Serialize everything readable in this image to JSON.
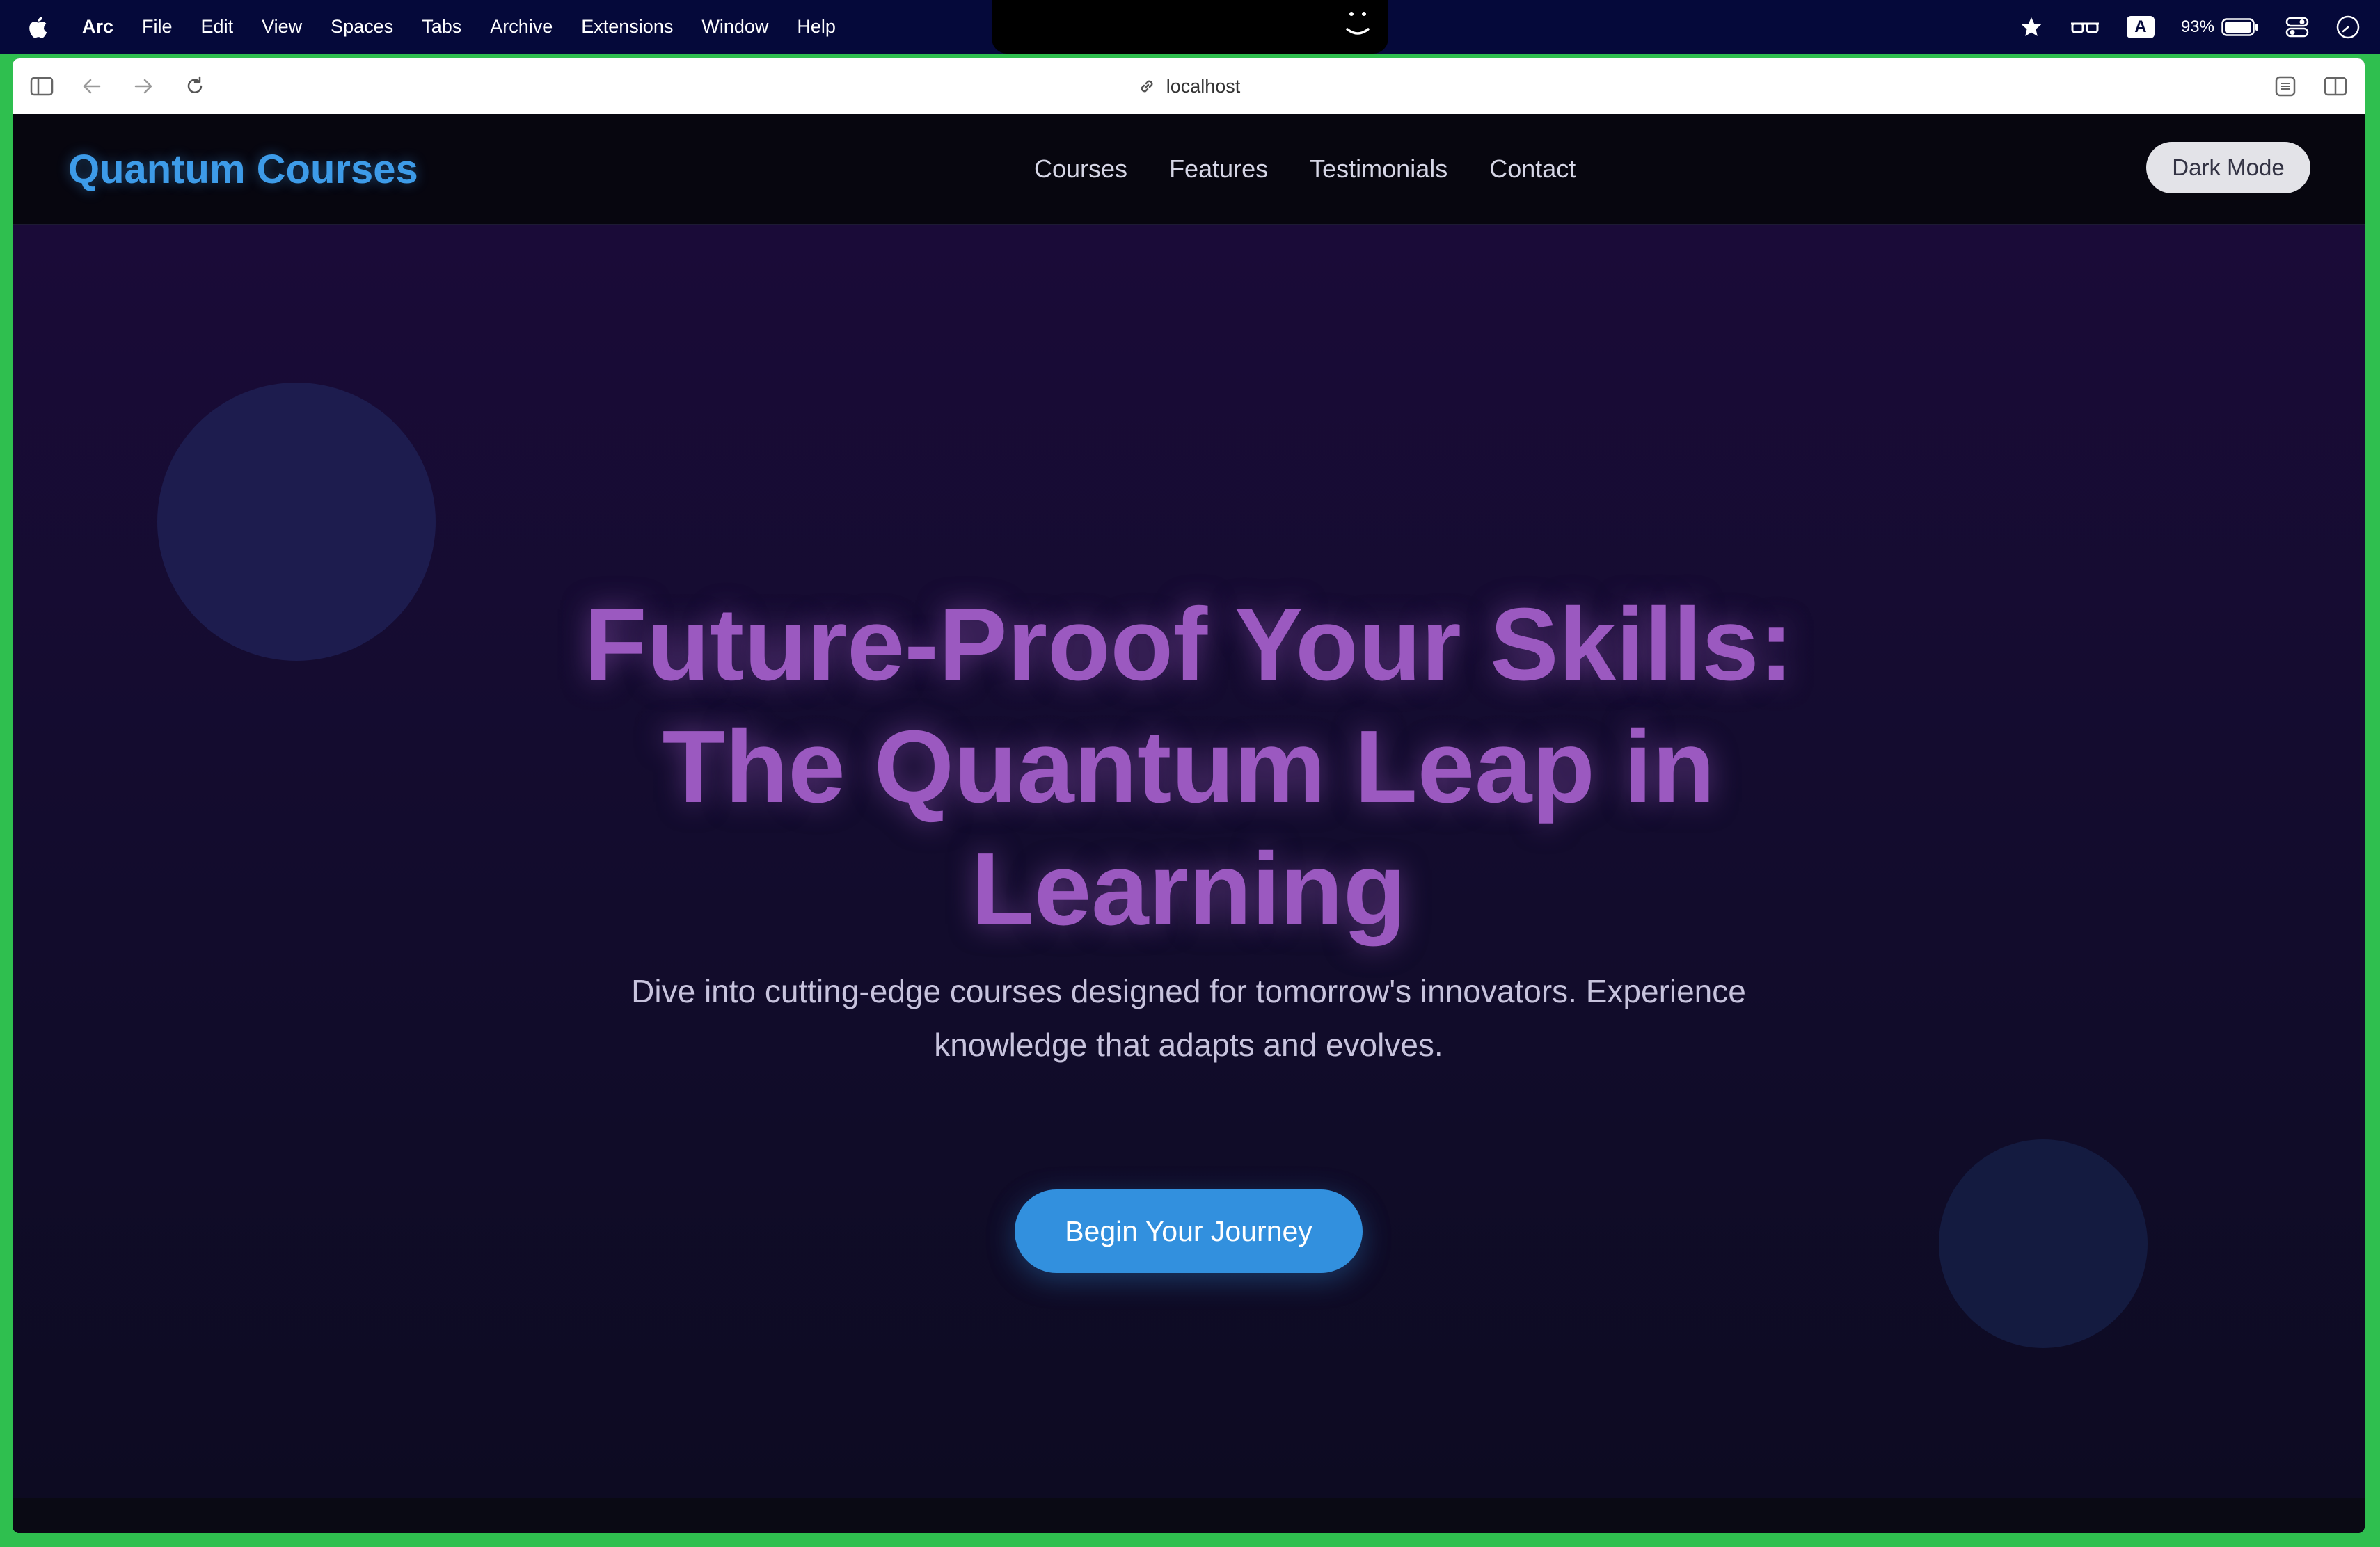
{
  "menubar": {
    "app_name": "Arc",
    "items": [
      "File",
      "Edit",
      "View",
      "Spaces",
      "Tabs",
      "Archive",
      "Extensions",
      "Window",
      "Help"
    ],
    "battery_percent": "93%",
    "input_source": "A"
  },
  "browser": {
    "url": "localhost"
  },
  "site": {
    "brand": "Quantum Courses",
    "nav": [
      "Courses",
      "Features",
      "Testimonials",
      "Contact"
    ],
    "theme_toggle_label": "Dark Mode",
    "accent_color": "#3d9be8",
    "heading_color": "#9b59c0"
  },
  "hero": {
    "title": "Future-Proof Your Skills: The Quantum Leap in Learning",
    "subtitle": "Dive into cutting-edge courses designed for tomorrow's innovators. Experience knowledge that adapts and evolves.",
    "cta_label": "Begin Your Journey"
  },
  "icons": [
    "apple-icon",
    "star-icon",
    "glasses-icon",
    "battery-icon",
    "control-center-icon",
    "clock-icon",
    "sidebar-toggle-icon",
    "back-arrow-icon",
    "forward-arrow-icon",
    "reload-icon",
    "link-icon",
    "capture-icon",
    "split-view-icon"
  ]
}
